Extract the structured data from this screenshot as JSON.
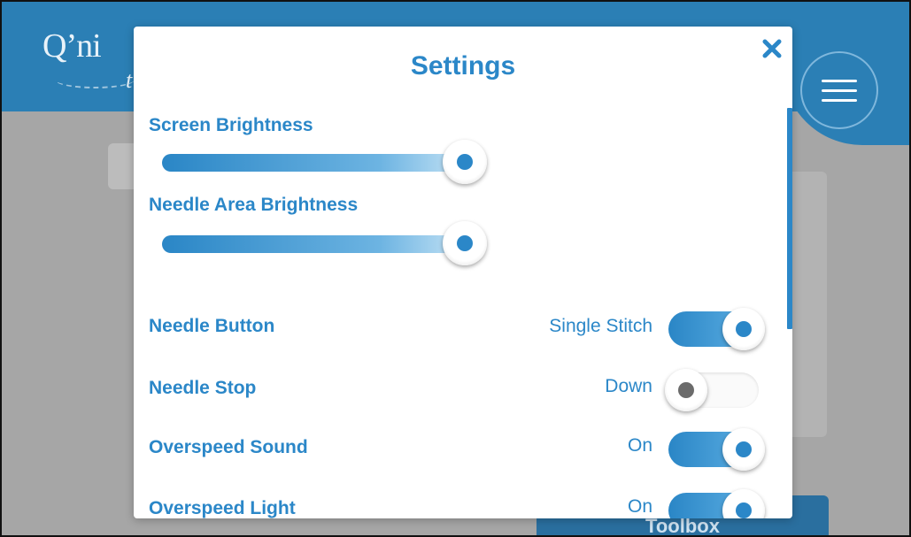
{
  "app": {
    "logo_text": "Q’ni",
    "logo_sub": "t",
    "toolbox_label": "Toolbox"
  },
  "modal": {
    "title": "Settings",
    "close_icon": "close-icon",
    "sliders": [
      {
        "label": "Screen Brightness",
        "level_percent": 96
      },
      {
        "label": "Needle Area Brightness",
        "level_percent": 96
      }
    ],
    "toggles": [
      {
        "label": "Needle Button",
        "value": "Single Stitch",
        "state": "on"
      },
      {
        "label": "Needle Stop",
        "value": "Down",
        "state": "off"
      },
      {
        "label": "Overspeed Sound",
        "value": "On",
        "state": "on"
      },
      {
        "label": "Overspeed Light",
        "value": "On",
        "state": "on"
      }
    ]
  },
  "colors": {
    "accent": "#2b87c8",
    "header_blue": "#2b7fb5",
    "overlay_gray": "#a6a6a6"
  }
}
